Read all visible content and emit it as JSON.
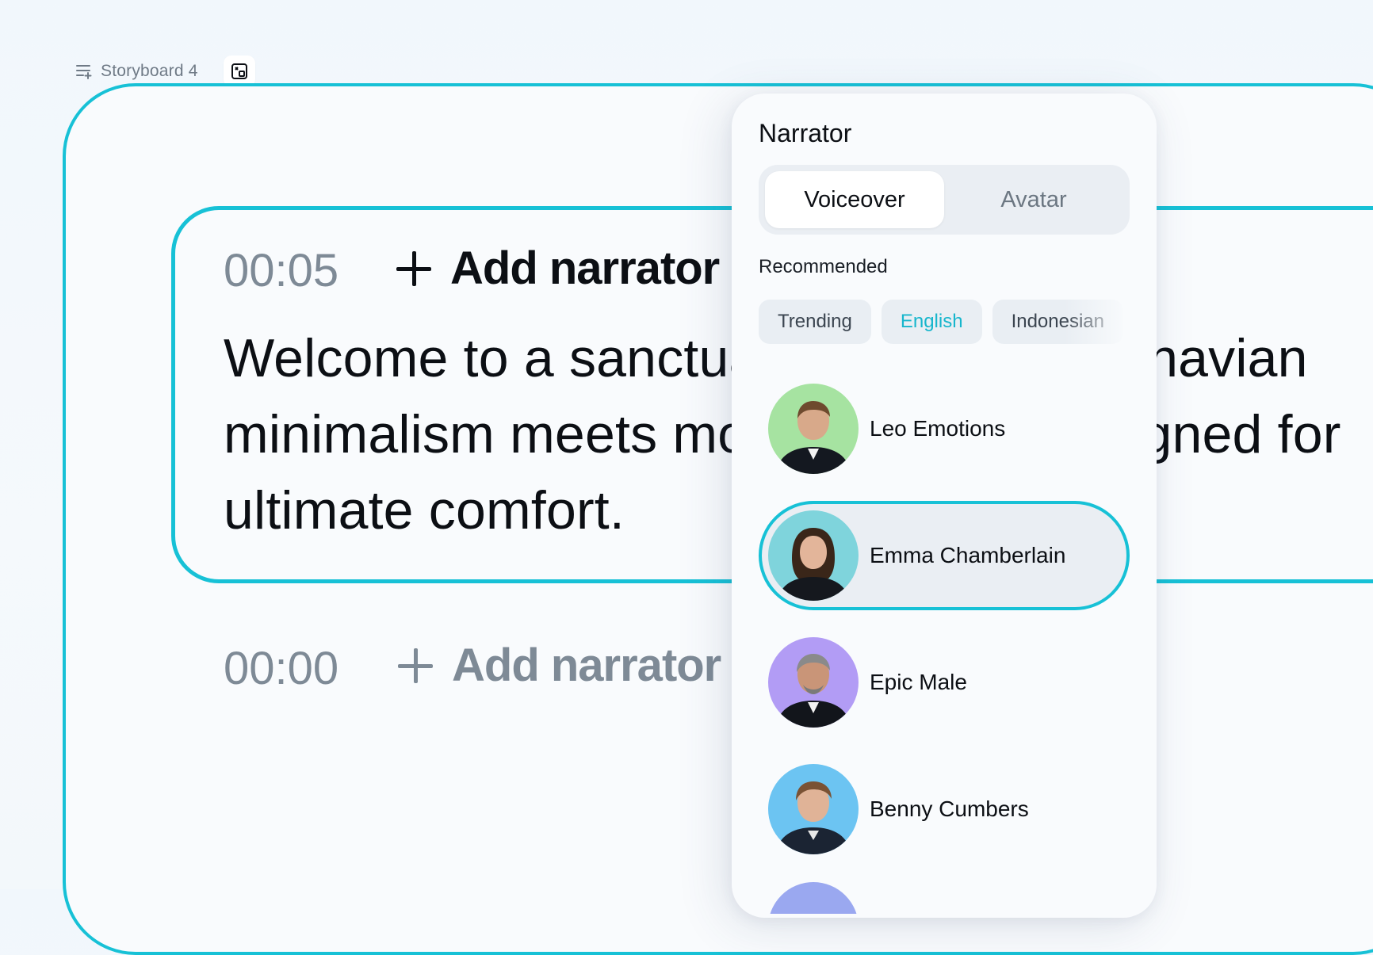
{
  "topbar": {
    "storyboard_label": "Storyboard 4"
  },
  "scenes": [
    {
      "time": "00:05",
      "add_label": "Add narrator",
      "script": "Welcome to a sanctuary where Scandinavian minimalism meets modern luxury, designed for ultimate comfort."
    },
    {
      "time": "00:00",
      "add_label": "Add narrator"
    }
  ],
  "panel": {
    "title": "Narrator",
    "tabs": [
      {
        "label": "Voiceover",
        "active": true
      },
      {
        "label": "Avatar",
        "active": false
      }
    ],
    "recommended_label": "Recommended",
    "chips": [
      {
        "label": "Trending",
        "active": false
      },
      {
        "label": "English",
        "active": true
      },
      {
        "label": "Indonesian",
        "active": false
      }
    ],
    "voices": [
      {
        "name": "Leo Emotions",
        "bg": "#a6e3a1",
        "selected": false
      },
      {
        "name": "Emma Chamberlain",
        "bg": "#7fd4dc",
        "selected": true
      },
      {
        "name": "Epic Male",
        "bg": "#b29cf5",
        "selected": false
      },
      {
        "name": "Benny Cumbers",
        "bg": "#6cc4f2",
        "selected": false
      }
    ]
  },
  "colors": {
    "accent": "#17c1d6",
    "muted_text": "#7e8a96"
  }
}
